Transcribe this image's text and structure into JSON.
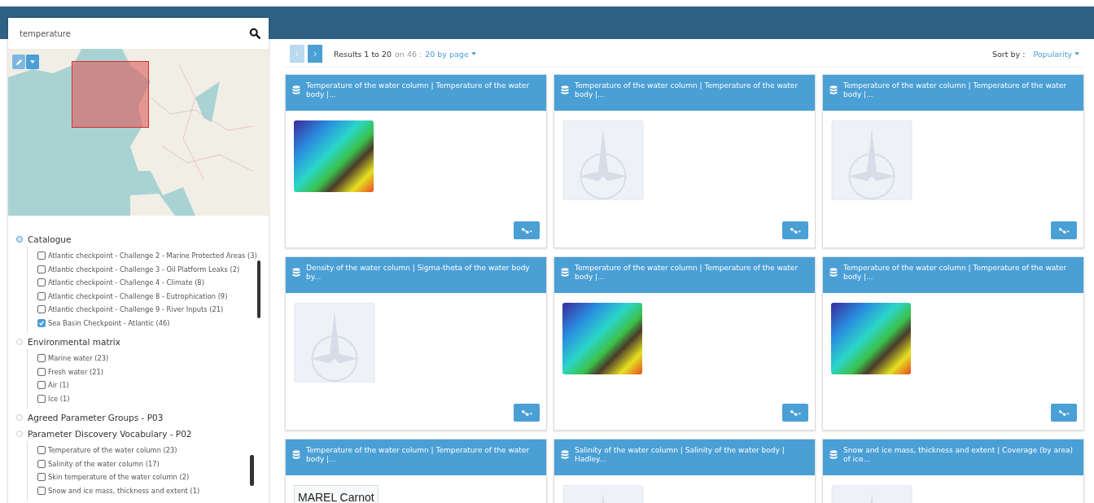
{
  "search": {
    "value": "temperature"
  },
  "map": {
    "tools": [
      {
        "kind": "draw"
      },
      {
        "kind": "menu"
      }
    ]
  },
  "facets": [
    {
      "title": "Catalogue",
      "highlighted": true,
      "scrollable": true,
      "items": [
        {
          "label": "Atlantic checkpoint - Challenge 2 - Marine Protected Areas (3)",
          "checked": false
        },
        {
          "label": "Atlantic checkpoint - Challenge 3 - Oil Platform Leaks (2)",
          "checked": false
        },
        {
          "label": "Atlantic checkpoint - Challenge 4 - Climate (8)",
          "checked": false
        },
        {
          "label": "Atlantic checkpoint - Challenge 8 - Eutrophication (9)",
          "checked": false
        },
        {
          "label": "Atlantic checkpoint - Challenge 9 - River Inputs (21)",
          "checked": false
        },
        {
          "label": "Sea Basin Checkpoint - Atlantic (46)",
          "checked": true
        }
      ]
    },
    {
      "title": "Environmental matrix",
      "highlighted": false,
      "scrollable": false,
      "items": [
        {
          "label": "Marine water (23)",
          "checked": false
        },
        {
          "label": "Fresh water (21)",
          "checked": false
        },
        {
          "label": "Air (1)",
          "checked": false
        },
        {
          "label": "Ice (1)",
          "checked": false
        }
      ]
    },
    {
      "title": "Agreed Parameter Groups - P03",
      "highlighted": false
    },
    {
      "title": "Parameter Discovery Vocabulary - P02",
      "highlighted": false,
      "scrollable": true,
      "items": [
        {
          "label": "Temperature of the water column (23)",
          "checked": false
        },
        {
          "label": "Salinity of the water column (17)",
          "checked": false
        },
        {
          "label": "Skin temperature of the water column (2)",
          "checked": false
        },
        {
          "label": "Snow and ice mass, thickness and extent (1)",
          "checked": false
        }
      ]
    }
  ],
  "pager": {
    "prev_disabled": true,
    "next_disabled": false,
    "results_range": "Results 1 to 20",
    "results_total": "on 46 :",
    "page_size": "20 by page"
  },
  "sort": {
    "label": "Sort by :",
    "value": "Popularity"
  },
  "cards": [
    {
      "title": "Temperature of the water column | Temperature of the water body |...",
      "kind": "map-image"
    },
    {
      "title": "Temperature of the water column | Temperature of the water body |...",
      "kind": "placeholder"
    },
    {
      "title": "Temperature of the water column | Temperature of the water body |...",
      "kind": "placeholder"
    },
    {
      "title": "Density of the water column | Sigma-theta of the water body by...",
      "kind": "placeholder"
    },
    {
      "title": "Temperature of the water column | Temperature of the water body |...",
      "kind": "map-image"
    },
    {
      "title": "Temperature of the water column | Temperature of the water body |...",
      "kind": "map-image"
    },
    {
      "title": "Temperature of the water column | Temperature of the water body |...",
      "kind": "text-logo",
      "logo_text": "MAREL Carnot"
    },
    {
      "title": "Salinity of the water column | Salinity of the water body | Hadley...",
      "kind": "placeholder"
    },
    {
      "title": "Snow and ice mass, thickness and extent | Coverage (by area) of ice...",
      "kind": "placeholder"
    }
  ]
}
